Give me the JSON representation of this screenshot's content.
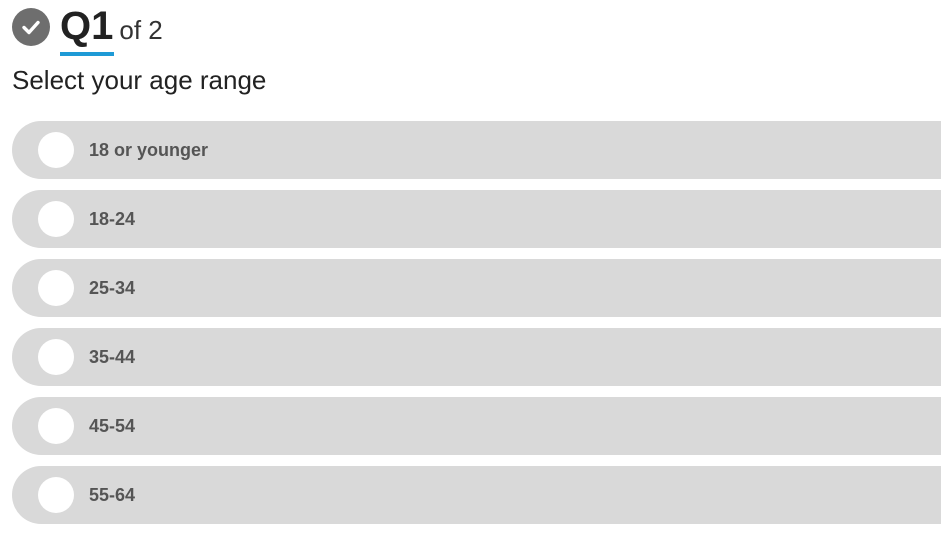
{
  "header": {
    "question_number": "Q1",
    "question_of": "of 2"
  },
  "question": {
    "text": "Select your age range"
  },
  "options": [
    {
      "label": "18 or younger"
    },
    {
      "label": "18-24"
    },
    {
      "label": "25-34"
    },
    {
      "label": "35-44"
    },
    {
      "label": "45-54"
    },
    {
      "label": "55-64"
    }
  ],
  "colors": {
    "accent": "#1e9ad6",
    "option_bg": "#d9d9d9",
    "check_bg": "#6e6e6e"
  },
  "icons": {
    "status": "checkmark-circle-icon",
    "radio": "radio-empty-icon"
  }
}
